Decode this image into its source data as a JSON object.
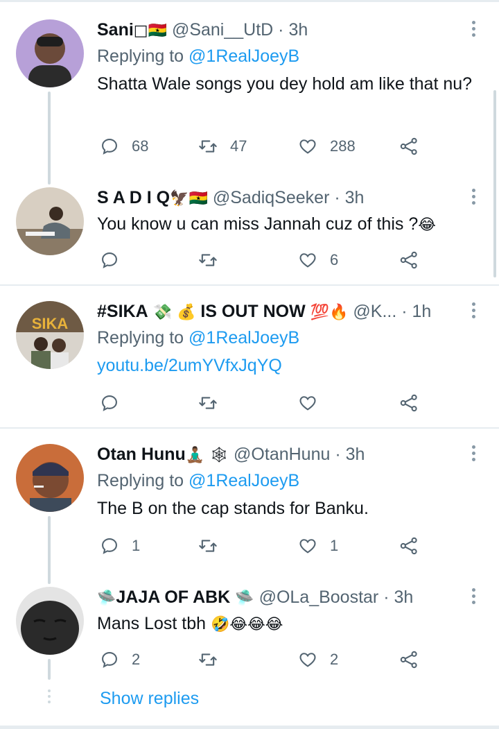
{
  "tweets": [
    {
      "name": "Sani",
      "name_emoji": "□🇬🇭",
      "handle": "@Sani__UtD",
      "time": "3h",
      "replying_prefix": "Replying to",
      "replying_to": "@1RealJoeyB",
      "text": "Shatta Wale songs you dey hold am like that nu?",
      "replies": "68",
      "retweets": "47",
      "likes": "288"
    },
    {
      "name": "S A D I Q",
      "name_emoji": "🦅🇬🇭",
      "handle": "@SadiqSeeker",
      "time": "3h",
      "text": "You know u can miss Jannah cuz of this ?",
      "text_emoji": "😂",
      "replies": "",
      "retweets": "",
      "likes": "6"
    },
    {
      "name": "#SIKA",
      "name_emoji_1": "💸",
      "name_emoji_2": "💰",
      "name_suffix": "IS OUT NOW",
      "name_emoji_3": "💯🔥",
      "handle": "@K...",
      "time": "1h",
      "replying_prefix": "Replying to",
      "replying_to": "@1RealJoeyB",
      "link": "youtu.be/2umYVfxJqYQ",
      "avatar_text": "SIKA",
      "replies": "",
      "retweets": "",
      "likes": ""
    },
    {
      "name": "Otan Hunu",
      "name_emoji": "🧘🏾‍♂️ 🕸",
      "handle": "@OtanHunu",
      "time": "3h",
      "replying_prefix": "Replying to",
      "replying_to": "@1RealJoeyB",
      "text": "The B on the cap stands for Banku.",
      "replies": "1",
      "retweets": "",
      "likes": "1"
    },
    {
      "name_emoji_pre": "🛸",
      "name": "JAJA OF ABK",
      "name_emoji": "🛸",
      "handle": "@OLa_Boostar",
      "time": "3h",
      "text": "Mans Lost tbh ",
      "text_emoji": "🤣😂😂😂",
      "replies": "2",
      "retweets": "",
      "likes": "2"
    }
  ],
  "show_replies": "Show replies",
  "separator": "·",
  "colors": {
    "link": "#1d9bf0",
    "secondary": "#536471",
    "divider": "#e6ecf0"
  }
}
